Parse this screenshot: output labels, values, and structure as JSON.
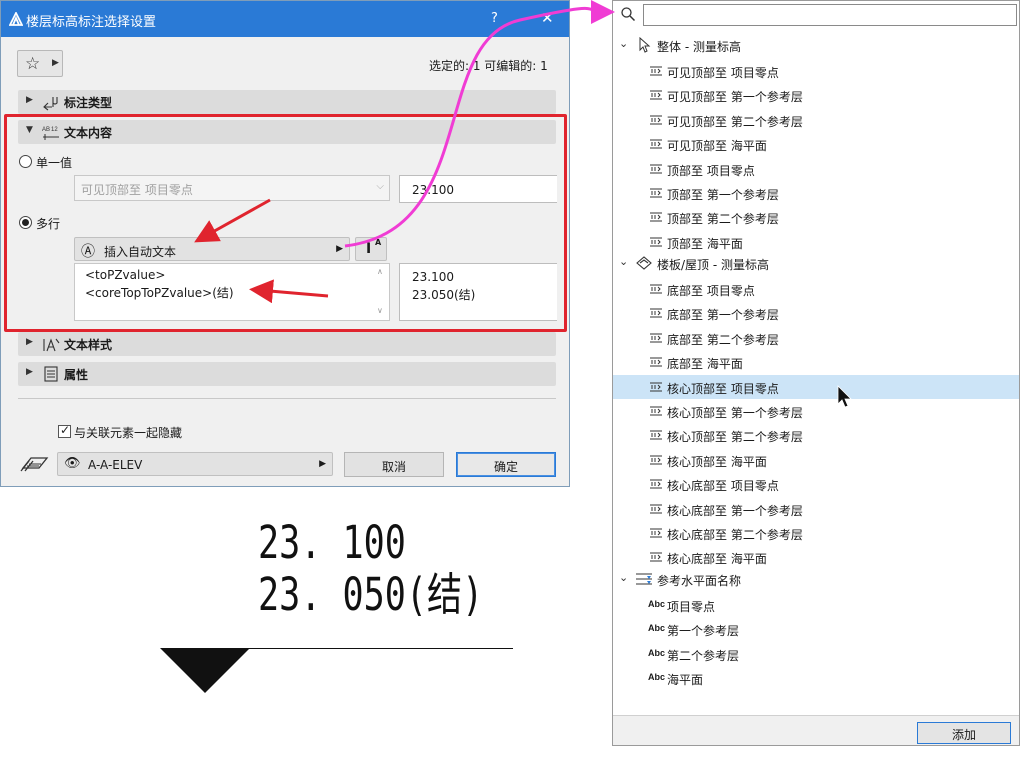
{
  "dialog": {
    "title": "楼层标高标注选择设置",
    "help_glyph": "?",
    "close_glyph": "✕",
    "selection_info": "选定的: 1 可编辑的: 1",
    "sections": {
      "annotation_type": "标注类型",
      "text_content": "文本内容",
      "text_style": "文本样式",
      "properties": "属性"
    },
    "single_value": {
      "label": "单一值",
      "combo_value": "可见顶部至 项目零点",
      "preview": "23.100"
    },
    "multi_line": {
      "label": "多行",
      "insert_button": "插入自动文本",
      "style_button_main": "I",
      "style_button_sup": "A",
      "lines": [
        "<toPZvalue>",
        "<coreTopToPZvalue>(结)"
      ],
      "preview_lines": [
        "23.100",
        "23.050(结)"
      ]
    },
    "hide_with_linked": "与关联元素一起隐藏",
    "layer": "A-A-ELEV",
    "cancel": "取消",
    "ok": "确定"
  },
  "preview": {
    "lines": [
      "23. 100",
      "23. 050(结)"
    ]
  },
  "popup": {
    "search_placeholder": "",
    "groups": [
      {
        "label": "整体 - 测量标高",
        "items": [
          "可见顶部至 项目零点",
          "可见顶部至 第一个参考层",
          "可见顶部至 第二个参考层",
          "可见顶部至 海平面",
          "顶部至 项目零点",
          "顶部至 第一个参考层",
          "顶部至 第二个参考层",
          "顶部至 海平面"
        ]
      },
      {
        "label": "楼板/屋顶 - 测量标高",
        "items": [
          "底部至 项目零点",
          "底部至 第一个参考层",
          "底部至 第二个参考层",
          "底部至 海平面",
          "核心顶部至 项目零点",
          "核心顶部至 第一个参考层",
          "核心顶部至 第二个参考层",
          "核心顶部至 海平面",
          "核心底部至 项目零点",
          "核心底部至 第一个参考层",
          "核心底部至 第二个参考层",
          "核心底部至 海平面"
        ]
      },
      {
        "label": "参考水平面名称",
        "items": [
          "项目零点",
          "第一个参考层",
          "第二个参考层",
          "海平面"
        ]
      }
    ],
    "abc_tag": "Abc",
    "selected_item": "核心顶部至 项目零点",
    "add_button": "添加"
  },
  "colors": {
    "titlebar": "#2a7ad6",
    "highlight_frame": "#e0242e",
    "selection": "#cce4f7",
    "pink_arrow": "#f03cd4",
    "red_arrow": "#e0242e"
  }
}
